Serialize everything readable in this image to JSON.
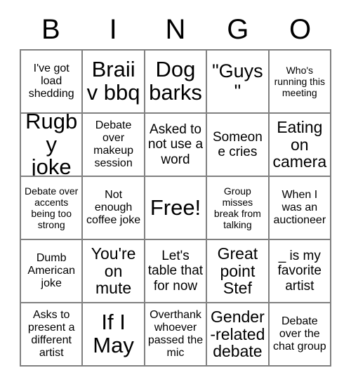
{
  "card": {
    "header_letters": [
      "B",
      "I",
      "N",
      "G",
      "O"
    ],
    "border_color": "#808080",
    "text_color": "#000000",
    "background_color": "#ffffff",
    "rows": 5,
    "columns": 5,
    "cells": [
      {
        "text": "I've got load shedding",
        "size": "sm",
        "free": false
      },
      {
        "text": "Braii v bbq",
        "size": "xxl",
        "free": false
      },
      {
        "text": "Dog barks",
        "size": "xxl",
        "free": false
      },
      {
        "text": "\"Guys\"",
        "size": "xl",
        "free": false
      },
      {
        "text": "Who's running this meeting",
        "size": "xs",
        "free": false
      },
      {
        "text": "Rugby joke",
        "size": "xxl",
        "free": false
      },
      {
        "text": "Debate over makeup session",
        "size": "sm",
        "free": false
      },
      {
        "text": "Asked to not use a word",
        "size": "md",
        "free": false
      },
      {
        "text": "Someone cries",
        "size": "md",
        "free": false
      },
      {
        "text": "Eating on camera",
        "size": "lg",
        "free": false
      },
      {
        "text": "Debate over accents being too strong",
        "size": "xs",
        "free": false
      },
      {
        "text": "Not enough coffee joke",
        "size": "sm",
        "free": false
      },
      {
        "text": "Free!",
        "size": "xxl",
        "free": true
      },
      {
        "text": "Group misses break from talking",
        "size": "xs",
        "free": false
      },
      {
        "text": "When I was an auctioneer",
        "size": "sm",
        "free": false
      },
      {
        "text": "Dumb American joke",
        "size": "sm",
        "free": false
      },
      {
        "text": "You're on mute",
        "size": "lg",
        "free": false
      },
      {
        "text": "Let's table that for now",
        "size": "md",
        "free": false
      },
      {
        "text": "Great point Stef",
        "size": "lg",
        "free": false
      },
      {
        "text": "_ is my favorite artist",
        "size": "md",
        "free": false
      },
      {
        "text": "Asks to present a different artist",
        "size": "sm",
        "free": false
      },
      {
        "text": "If I May",
        "size": "xxl",
        "free": false
      },
      {
        "text": "Overthank whoever passed the mic",
        "size": "sm",
        "free": false
      },
      {
        "text": "Gender-related debate",
        "size": "lg",
        "free": false
      },
      {
        "text": "Debate over the chat group",
        "size": "sm",
        "free": false
      }
    ]
  }
}
